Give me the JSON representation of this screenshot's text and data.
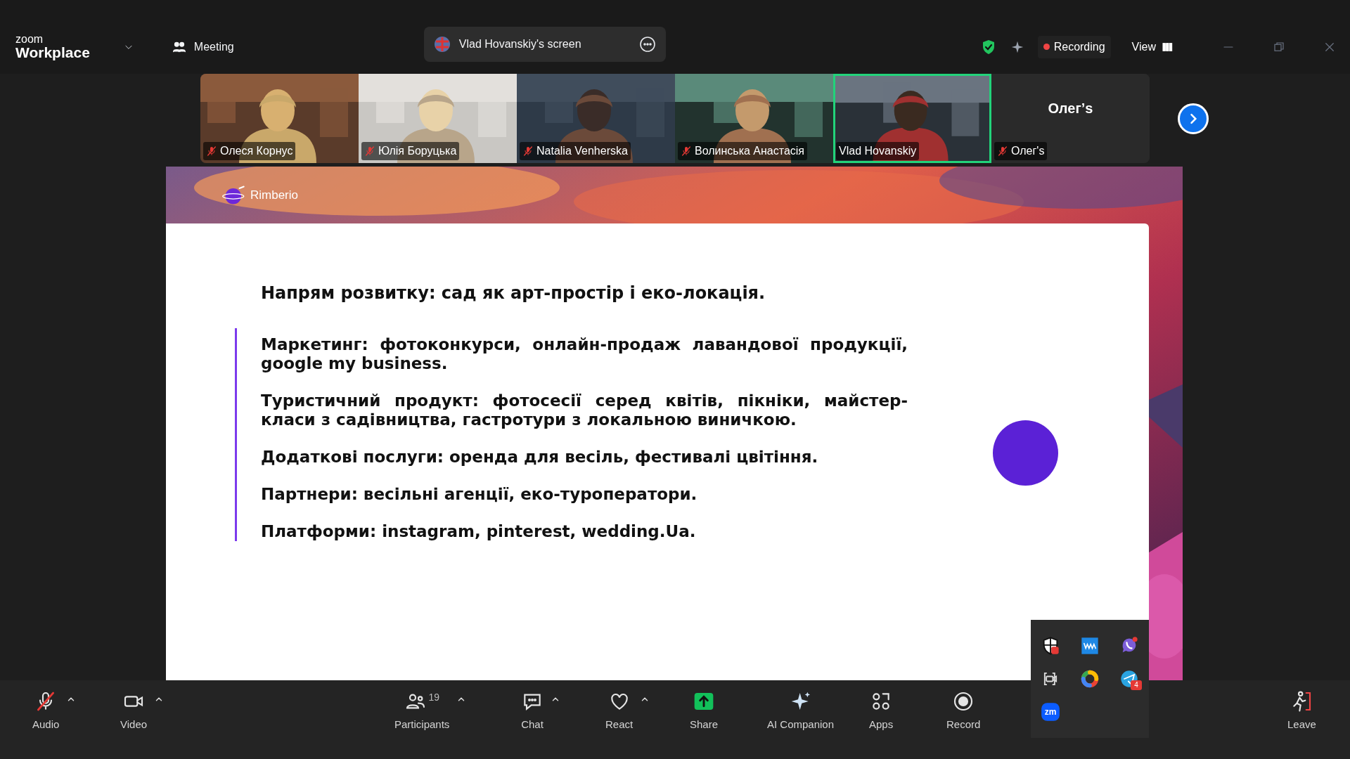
{
  "app": {
    "logo_top": "zoom",
    "logo_bottom": "Workplace"
  },
  "meeting_button": {
    "label": "Meeting"
  },
  "share_tab": {
    "label": "Vlad Hovanskiy's screen"
  },
  "recording": {
    "label": "Recording"
  },
  "view_button": {
    "label": "View"
  },
  "participants": [
    {
      "kind": "video",
      "name": "Олеся Корнус",
      "muted": true,
      "speaking": false
    },
    {
      "kind": "video",
      "name": "Юлія Боруцька",
      "muted": true,
      "speaking": false
    },
    {
      "kind": "video",
      "name": "Natalia Venherska",
      "muted": true,
      "speaking": false
    },
    {
      "kind": "video",
      "name": "Волинська Анастасія",
      "muted": true,
      "speaking": false
    },
    {
      "kind": "video",
      "name": "Vlad Hovanskiy",
      "muted": false,
      "speaking": true
    },
    {
      "kind": "name_only",
      "display": "Олег’s",
      "name": "Олег's",
      "muted": true,
      "speaking": false
    }
  ],
  "slide": {
    "brand": "Rimberio",
    "heading": "Напрям розвитку: сад як арт-простір і еко-локація.",
    "points": [
      "Маркетинг: фотоконкурси, онлайн-продаж лавандової продукції, google my business.",
      "Туристичний продукт: фотосесії серед квітів, пікніки, майстер-класи з садівництва, гастротури з локальною виничкою.",
      "Додаткові послуги: оренда для весіль, фестивалі цвітіння.",
      "Партнери: весільні агенції, еко-туроператори.",
      "Платформи: instagram, pinterest, wedding.Ua."
    ]
  },
  "toolbar": [
    {
      "kind": "audio",
      "label": "Audio",
      "muted": true,
      "caret": true
    },
    {
      "kind": "video",
      "label": "Video",
      "caret": true
    },
    {
      "kind": "participants",
      "label": "Participants",
      "count": "19",
      "caret": true
    },
    {
      "kind": "chat",
      "label": "Chat",
      "caret": true
    },
    {
      "kind": "react",
      "label": "React",
      "caret": true
    },
    {
      "kind": "share",
      "label": "Share",
      "caret": false
    },
    {
      "kind": "ai",
      "label": "AI Companion",
      "caret": false
    },
    {
      "kind": "apps",
      "label": "Apps",
      "caret": false
    },
    {
      "kind": "record",
      "label": "Record",
      "caret": false
    },
    {
      "kind": "leave",
      "label": "Leave",
      "caret": false
    }
  ],
  "tray": [
    {
      "kind": "shield"
    },
    {
      "kind": "waves"
    },
    {
      "kind": "phone"
    },
    {
      "kind": "camera"
    },
    {
      "kind": "ring"
    },
    {
      "kind": "telegram",
      "badge": "4"
    },
    {
      "kind": "zoom",
      "text": "zm"
    }
  ]
}
